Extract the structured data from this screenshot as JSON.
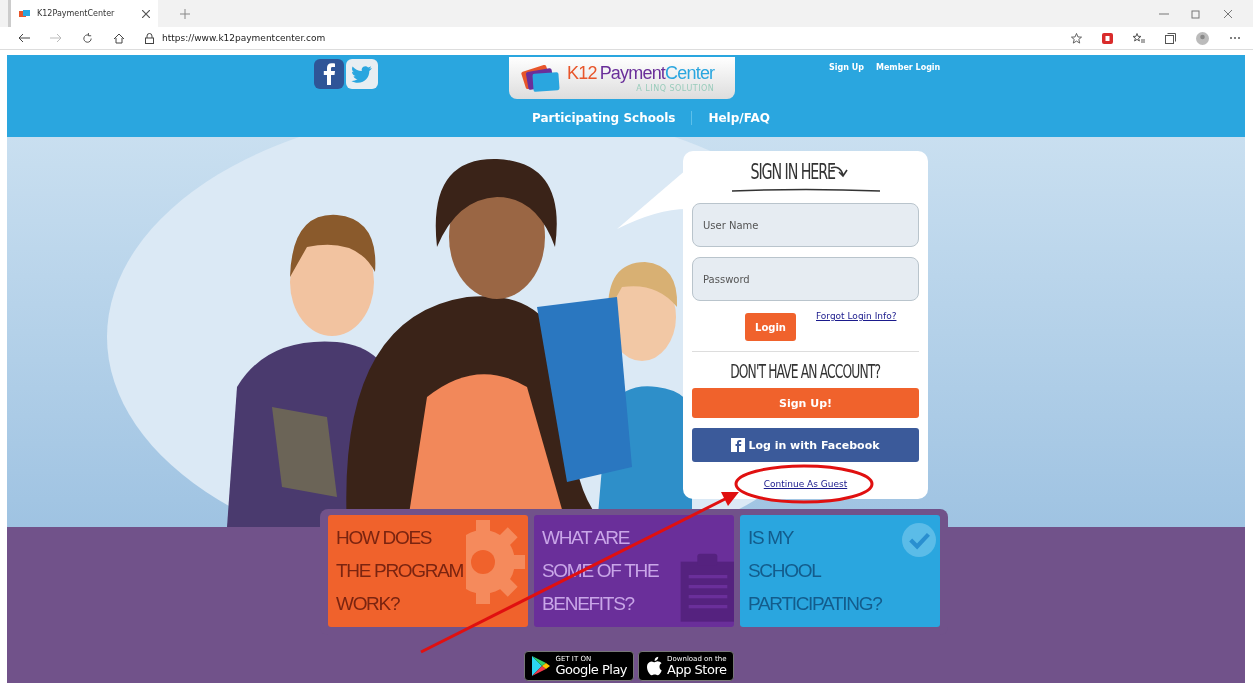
{
  "browser": {
    "tab_title": "K12PaymentCenter",
    "url": "https://www.k12paymentcenter.com"
  },
  "header": {
    "logo": {
      "parts": [
        "K12",
        "Payment",
        "Center"
      ],
      "tagline": "A LINQ SOLUTION"
    },
    "top_links": [
      "Sign Up",
      "Member Login"
    ],
    "menu": [
      "Participating Schools",
      "Help/FAQ"
    ]
  },
  "signin": {
    "title": "SIGN IN HERE",
    "username_placeholder": "User Name",
    "password_placeholder": "Password",
    "login_button": "Login",
    "forgot_link": "Forgot Login Info?",
    "no_account": "DON'T HAVE AN ACCOUNT?",
    "signup_button": "Sign Up!",
    "facebook_button": "Log in with Facebook",
    "guest_link": "Continue As Guest"
  },
  "tiles": [
    {
      "kind": "gear",
      "color": "#f0622c",
      "lines": [
        "HOW DOES",
        "THE PROGRAM",
        "WORK?"
      ]
    },
    {
      "kind": "clipboard",
      "color": "#6a2f9a",
      "lines": [
        "WHAT ARE",
        "SOME OF THE",
        "BENEFITS?"
      ]
    },
    {
      "kind": "check",
      "color": "#2aa6df",
      "lines": [
        "IS MY",
        "SCHOOL",
        "PARTICIPATING?"
      ]
    }
  ],
  "store_badges": [
    {
      "kind": "google",
      "small": "GET IT ON",
      "big": "Google Play"
    },
    {
      "kind": "apple",
      "small": "Download on the",
      "big": "App Store"
    }
  ]
}
